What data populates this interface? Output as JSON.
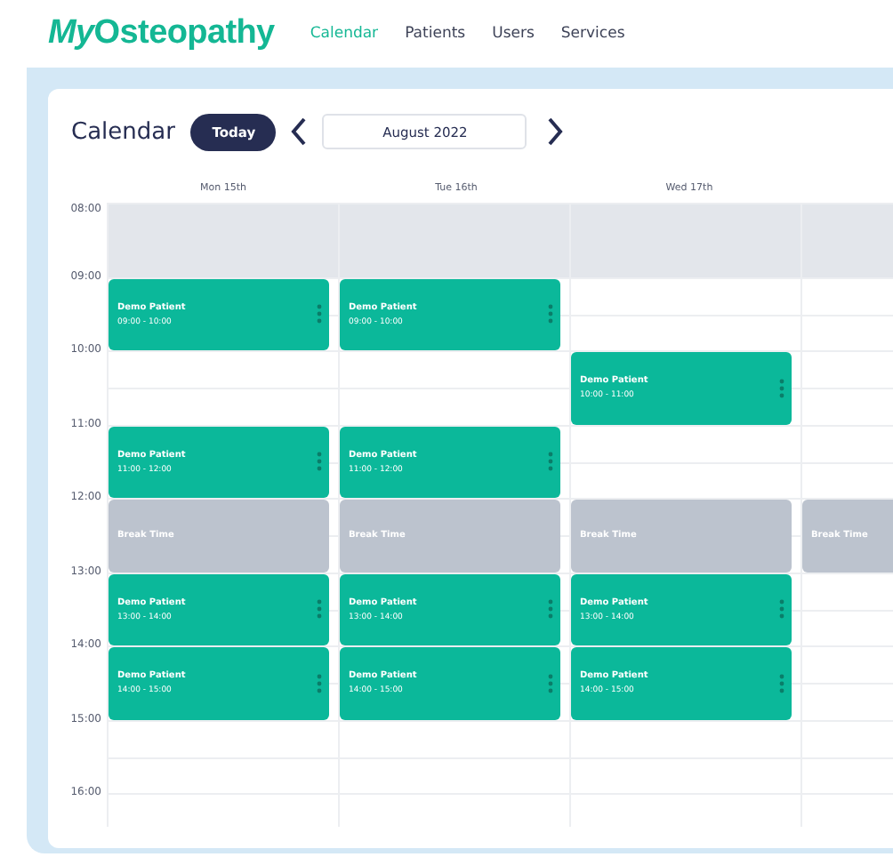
{
  "brand": {
    "logo_parts": [
      "My",
      "Osteopathy"
    ]
  },
  "nav": [
    {
      "label": "Calendar",
      "selected": true
    },
    {
      "label": "Patients",
      "selected": false
    },
    {
      "label": "Users",
      "selected": false
    },
    {
      "label": "Services",
      "selected": false
    }
  ],
  "calendar": {
    "title": "Calendar",
    "today_button": "Today",
    "period": "August 2022",
    "day_headings": [
      "Mon 15th",
      "Tue 16th",
      "Wed 17th"
    ],
    "hours": [
      {
        "label": "08:00",
        "shaded": true,
        "cells": [
          {
            "kind": "empty"
          },
          {
            "kind": "empty"
          },
          {
            "kind": "empty"
          },
          {
            "kind": "empty"
          }
        ]
      },
      {
        "label": "09:00",
        "shaded": false,
        "cells": [
          {
            "kind": "appointment",
            "name": "Demo Patient",
            "time": "09:00 - 10:00"
          },
          {
            "kind": "appointment",
            "name": "Demo Patient",
            "time": "09:00 - 10:00"
          },
          {
            "kind": "empty"
          },
          {
            "kind": "empty"
          }
        ]
      },
      {
        "label": "10:00",
        "shaded": false,
        "cells": [
          {
            "kind": "empty"
          },
          {
            "kind": "empty"
          },
          {
            "kind": "appointment",
            "name": "Demo Patient",
            "time": "10:00 - 11:00"
          },
          {
            "kind": "empty"
          }
        ]
      },
      {
        "label": "11:00",
        "shaded": false,
        "cells": [
          {
            "kind": "appointment",
            "name": "Demo Patient",
            "time": "11:00 - 12:00"
          },
          {
            "kind": "appointment",
            "name": "Demo Patient",
            "time": "11:00 - 12:00"
          },
          {
            "kind": "empty"
          },
          {
            "kind": "empty"
          }
        ]
      },
      {
        "label": "12:00",
        "shaded": false,
        "cells": [
          {
            "kind": "break",
            "name": "Break Time"
          },
          {
            "kind": "break",
            "name": "Break Time"
          },
          {
            "kind": "break",
            "name": "Break Time"
          },
          {
            "kind": "break",
            "name": "Break Time"
          }
        ]
      },
      {
        "label": "13:00",
        "shaded": false,
        "cells": [
          {
            "kind": "appointment",
            "name": "Demo Patient",
            "time": "13:00 - 14:00"
          },
          {
            "kind": "appointment",
            "name": "Demo Patient",
            "time": "13:00 - 14:00"
          },
          {
            "kind": "appointment",
            "name": "Demo Patient",
            "time": "13:00 - 14:00"
          },
          {
            "kind": "empty"
          }
        ]
      },
      {
        "label": "14:00",
        "shaded": false,
        "cells": [
          {
            "kind": "appointment",
            "name": "Demo Patient",
            "time": "14:00 - 15:00"
          },
          {
            "kind": "appointment",
            "name": "Demo Patient",
            "time": "14:00 - 15:00"
          },
          {
            "kind": "appointment",
            "name": "Demo Patient",
            "time": "14:00 - 15:00"
          },
          {
            "kind": "empty"
          }
        ]
      },
      {
        "label": "15:00",
        "shaded": false,
        "cells": [
          {
            "kind": "empty"
          },
          {
            "kind": "empty"
          },
          {
            "kind": "empty"
          },
          {
            "kind": "empty"
          }
        ]
      },
      {
        "label": "16:00",
        "shaded": false,
        "cells": [
          {
            "kind": "empty"
          },
          {
            "kind": "empty"
          },
          {
            "kind": "empty"
          },
          {
            "kind": "empty"
          }
        ]
      }
    ]
  }
}
